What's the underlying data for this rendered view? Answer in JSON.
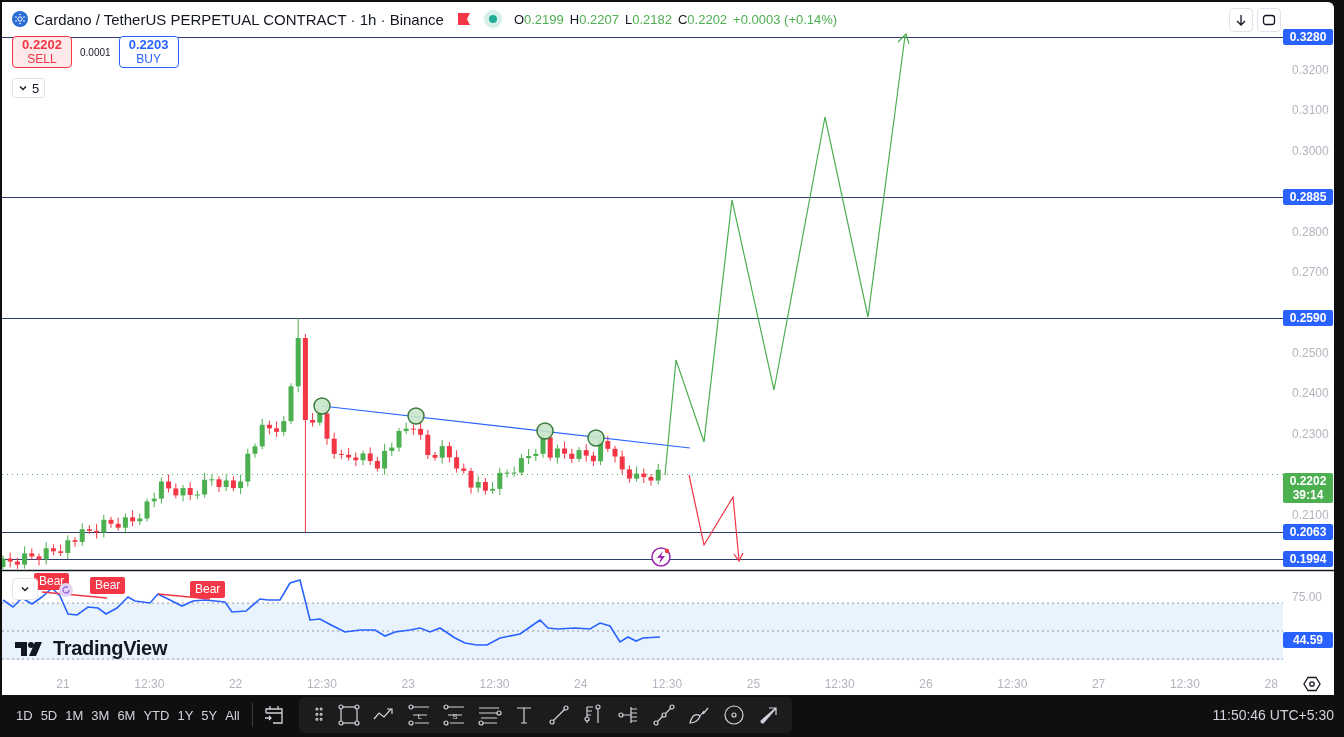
{
  "header": {
    "symbol": "Cardano / TetherUS PERPETUAL CONTRACT · 1h · Binance",
    "market_open": true,
    "ohlc": [
      {
        "key": "O",
        "value": "0.2199"
      },
      {
        "key": "H",
        "value": "0.2207"
      },
      {
        "key": "L",
        "value": "0.2182"
      },
      {
        "key": "C",
        "value": "0.2202"
      }
    ],
    "change": "+0.0003 (+0.14%)"
  },
  "trade": {
    "sell": {
      "price": "0.2202",
      "label": "SELL"
    },
    "spread": "0.0001",
    "buy": {
      "price": "0.2203",
      "label": "BUY"
    }
  },
  "indicators_toggle": {
    "count": "5",
    "expanded": false
  },
  "price_axis": {
    "ticks": [
      "0.3200",
      "0.3100",
      "0.3000",
      "0.2800",
      "0.2700",
      "0.2500",
      "0.2400",
      "0.2300",
      "0.2100"
    ],
    "markers": [
      {
        "kind": "level",
        "value": "0.3280"
      },
      {
        "kind": "level",
        "value": "0.2885"
      },
      {
        "kind": "level",
        "value": "0.2590"
      },
      {
        "kind": "last",
        "value": "0.2202",
        "countdown": "39:14"
      },
      {
        "kind": "level",
        "value": "0.2063"
      },
      {
        "kind": "level",
        "value": "0.1994"
      }
    ]
  },
  "rsi": {
    "ticks": [
      "75.00"
    ],
    "value": "44.59",
    "signals": [
      {
        "label": "Bear"
      },
      {
        "label": "Bear"
      },
      {
        "label": "Bear"
      }
    ]
  },
  "logo_text": "TradingView",
  "time_axis": [
    "21",
    "12:30",
    "22",
    "12:30",
    "23",
    "12:30",
    "24",
    "12:30",
    "25",
    "12:30",
    "26",
    "12:30",
    "27",
    "12:30",
    "28"
  ],
  "bottom_bar": {
    "ranges": [
      "1D",
      "5D",
      "1M",
      "3M",
      "6M",
      "YTD",
      "1Y",
      "5Y",
      "All"
    ],
    "tools": [
      {
        "kind": "handle"
      },
      {
        "kind": "rect"
      },
      {
        "kind": "path"
      },
      {
        "kind": "long",
        "letter": "L"
      },
      {
        "kind": "short",
        "letter": "S"
      },
      {
        "kind": "channel"
      },
      {
        "kind": "text"
      },
      {
        "kind": "line"
      },
      {
        "kind": "pitchfork"
      },
      {
        "kind": "fork"
      },
      {
        "kind": "segments"
      },
      {
        "kind": "brush"
      },
      {
        "kind": "target"
      },
      {
        "kind": "arrow"
      }
    ],
    "time": "11:50:46 UTC+5:30"
  }
}
